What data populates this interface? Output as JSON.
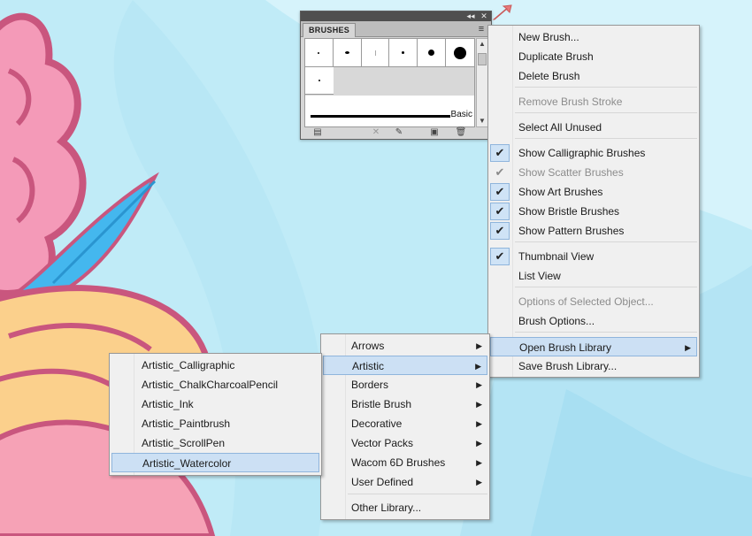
{
  "panel": {
    "tab_label": "BRUSHES",
    "basic_label": "Basic",
    "collapse_icon": "double-left-arrow",
    "close_icon": "close-x",
    "menu_icon": "panel-menu-lines"
  },
  "main_menu": {
    "items": [
      {
        "label": "New Brush...",
        "enabled": true,
        "checked": false
      },
      {
        "label": "Duplicate Brush",
        "enabled": true,
        "checked": false
      },
      {
        "label": "Delete Brush",
        "enabled": true,
        "checked": false
      },
      {
        "label": "Remove Brush Stroke",
        "enabled": false,
        "checked": false
      },
      {
        "label": "Select All Unused",
        "enabled": true,
        "checked": false
      },
      {
        "label": "Show Calligraphic Brushes",
        "enabled": true,
        "checked": true
      },
      {
        "label": "Show Scatter Brushes",
        "enabled": false,
        "checked": true
      },
      {
        "label": "Show Art Brushes",
        "enabled": true,
        "checked": true
      },
      {
        "label": "Show Bristle Brushes",
        "enabled": true,
        "checked": true
      },
      {
        "label": "Show Pattern Brushes",
        "enabled": true,
        "checked": true
      },
      {
        "label": "Thumbnail View",
        "enabled": true,
        "checked": true
      },
      {
        "label": "List View",
        "enabled": true,
        "checked": false
      },
      {
        "label": "Options of Selected Object...",
        "enabled": false,
        "checked": false
      },
      {
        "label": "Brush Options...",
        "enabled": true,
        "checked": false
      },
      {
        "label": "Open Brush Library",
        "enabled": true,
        "checked": false,
        "submenu": true,
        "highlighted": true
      },
      {
        "label": "Save Brush Library...",
        "enabled": true,
        "checked": false
      }
    ]
  },
  "library_menu": {
    "items": [
      {
        "label": "Arrows",
        "submenu": true
      },
      {
        "label": "Artistic",
        "submenu": true,
        "highlighted": true
      },
      {
        "label": "Borders",
        "submenu": true
      },
      {
        "label": "Bristle Brush",
        "submenu": true
      },
      {
        "label": "Decorative",
        "submenu": true
      },
      {
        "label": "Vector Packs",
        "submenu": true
      },
      {
        "label": "Wacom 6D Brushes",
        "submenu": true
      },
      {
        "label": "User Defined",
        "submenu": true
      },
      {
        "label": "Other Library...",
        "submenu": false
      }
    ]
  },
  "artistic_menu": {
    "items": [
      {
        "label": "Artistic_Calligraphic"
      },
      {
        "label": "Artistic_ChalkCharcoalPencil"
      },
      {
        "label": "Artistic_Ink"
      },
      {
        "label": "Artistic_Paintbrush"
      },
      {
        "label": "Artistic_ScrollPen"
      },
      {
        "label": "Artistic_Watercolor",
        "highlighted": true
      }
    ]
  },
  "glyphs": {
    "check": "✔",
    "submenu_arrow": "▶"
  },
  "colors": {
    "menu_highlight": "#cce0f4",
    "menu_highlight_border": "#8fb5dc",
    "pointer_arrow": "#e87a7a"
  }
}
